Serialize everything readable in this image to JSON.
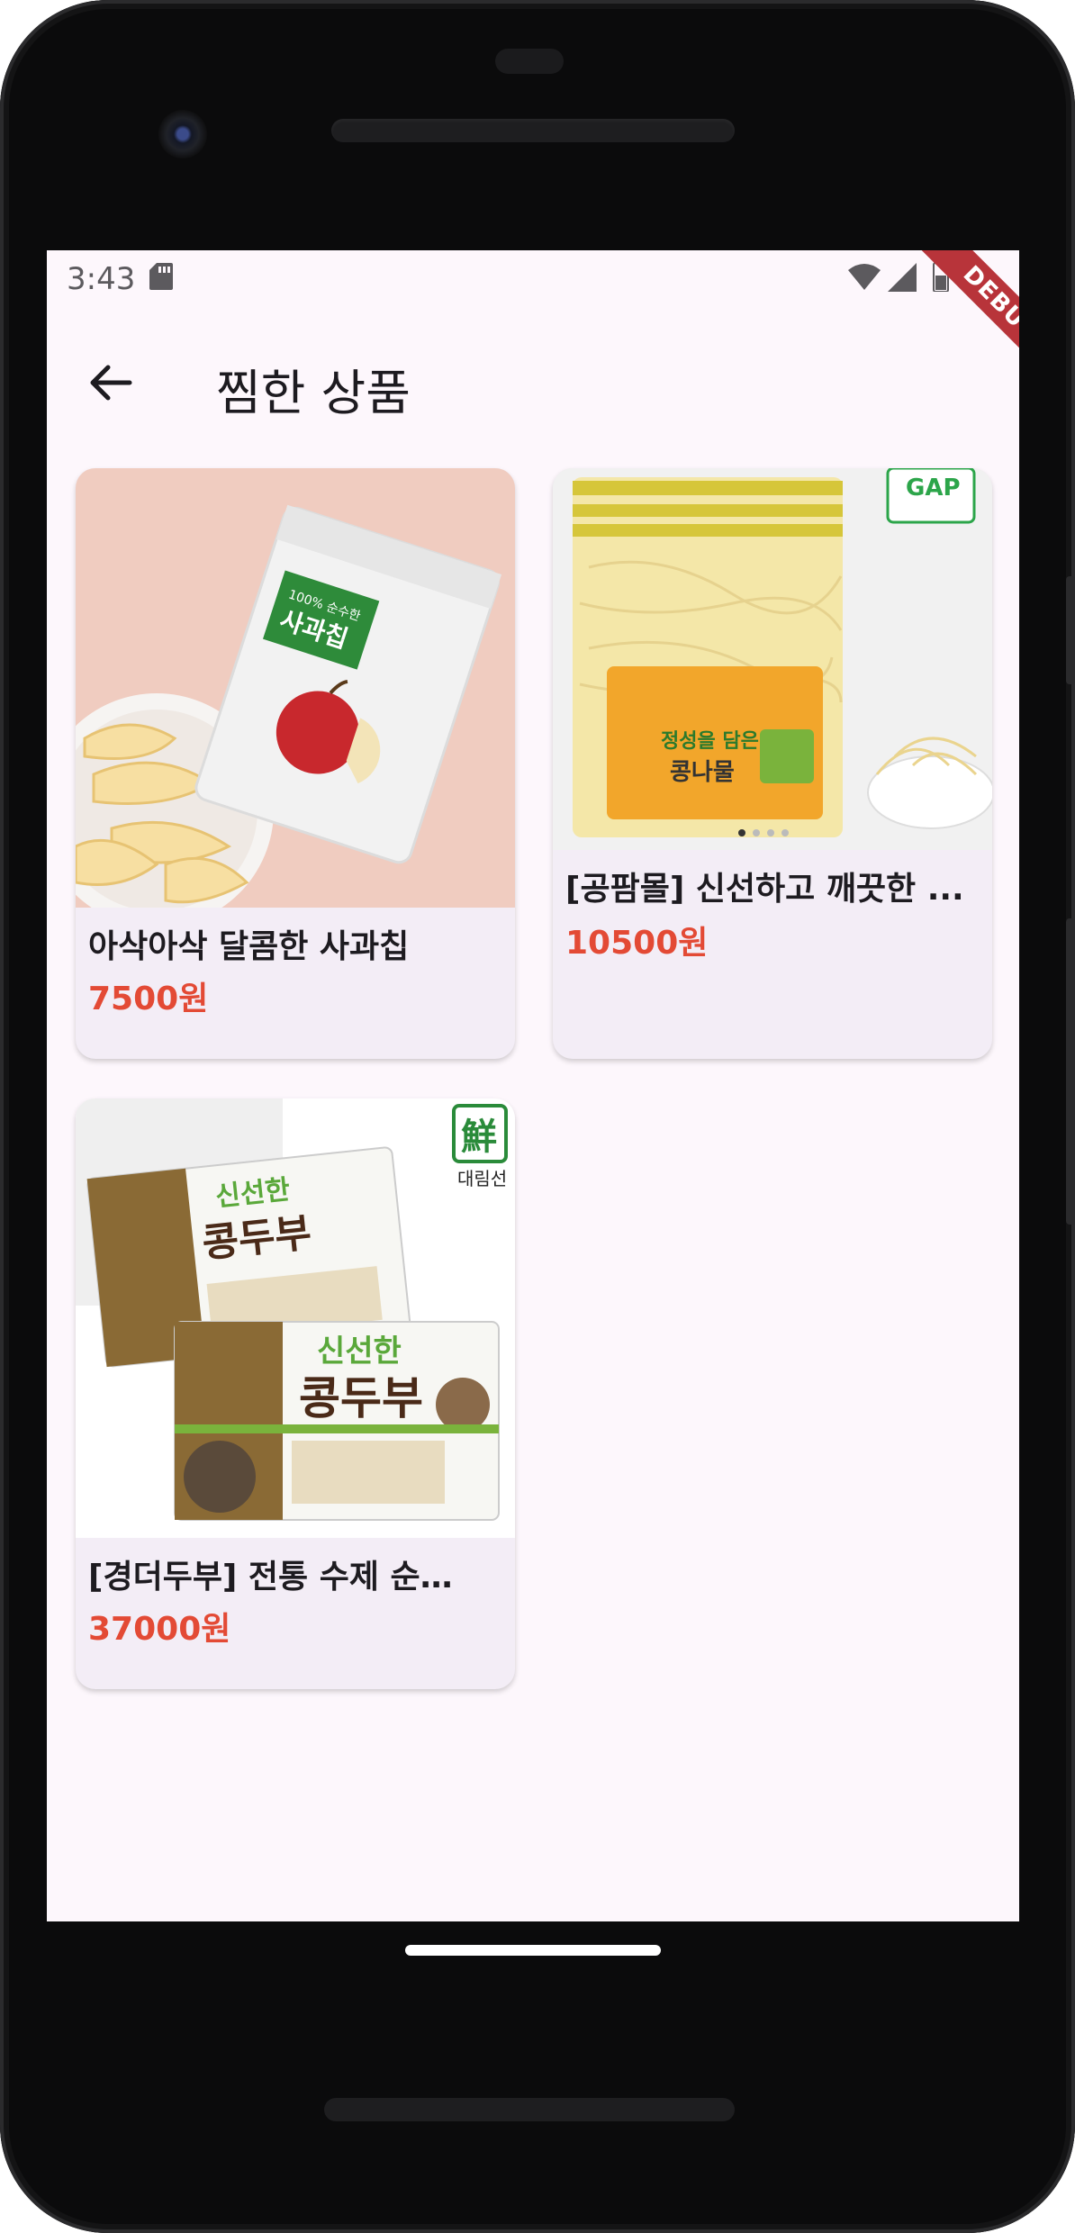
{
  "status_bar": {
    "time": "3:43",
    "debug_label": "DEBUG"
  },
  "app_bar": {
    "title": "찜한 상품",
    "back_icon": "arrow-back-icon"
  },
  "products": [
    {
      "name": "아삭아삭 달콤한 사과칩",
      "price": "7500원",
      "image": "apple-chips-photo",
      "package_text": "100% 순수한",
      "package_title": "사과칩"
    },
    {
      "name": "[공팜몰] 신선하고 깨끗한 ...",
      "price": "10500원",
      "image": "bean-sprouts-photo",
      "package_text": "정성을 담은",
      "package_title": "콩나물",
      "badge": "GAP"
    },
    {
      "name": "[경더두부] 전통 수제 순…",
      "price": "37000원",
      "image": "tofu-photo",
      "package_text": "신선한",
      "package_title": "콩두부",
      "brand": "대림선",
      "brand_char": "鮮"
    }
  ],
  "colors": {
    "price": "#e34a35",
    "background": "#fdf7fc",
    "card": "#f3edf6"
  }
}
